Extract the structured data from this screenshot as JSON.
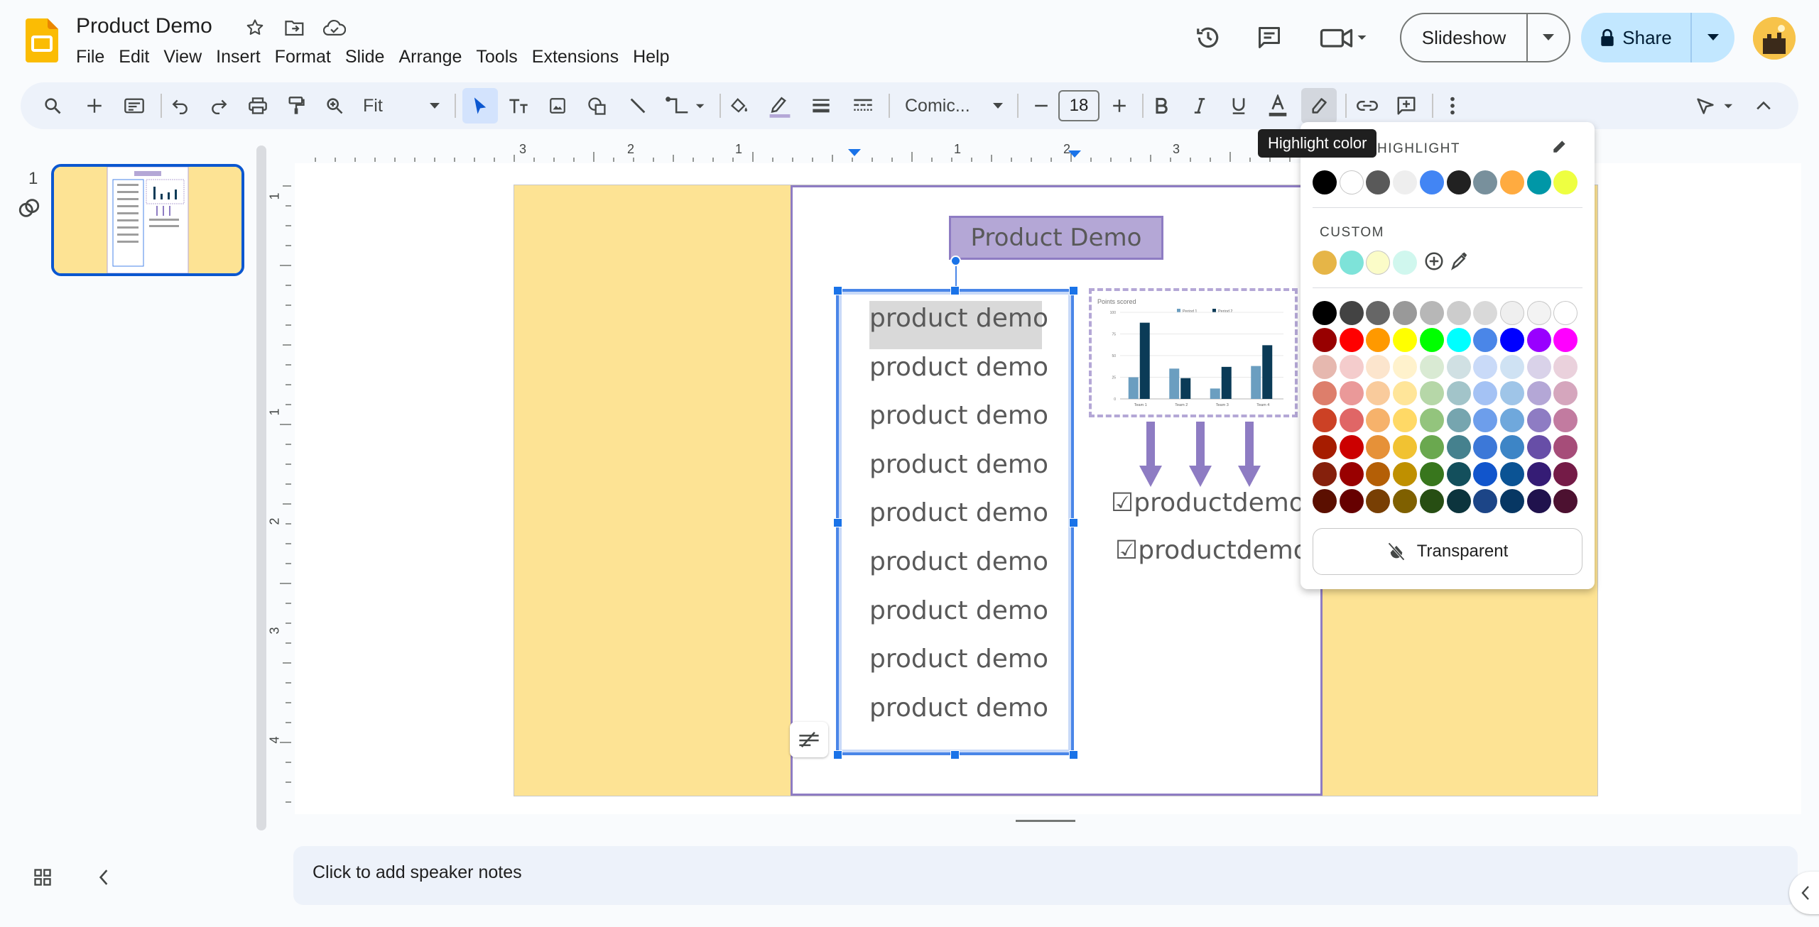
{
  "app": {
    "name": "Google Slides"
  },
  "document": {
    "title": "Product Demo"
  },
  "menu": [
    "File",
    "Edit",
    "View",
    "Insert",
    "Format",
    "Slide",
    "Arrange",
    "Tools",
    "Extensions",
    "Help"
  ],
  "header": {
    "slideshow_label": "Slideshow",
    "share_label": "Share"
  },
  "toolbar": {
    "zoom_label": "Fit",
    "font_label": "Comic...",
    "font_size": "18"
  },
  "tooltip": {
    "text": "Highlight color"
  },
  "ruler": {
    "horizontal": [
      "3",
      "2",
      "1",
      "1",
      "2",
      "3"
    ],
    "vertical": [
      "1",
      "1",
      "2",
      "3",
      "4"
    ]
  },
  "slides_panel": {
    "slide_number": "1"
  },
  "slide": {
    "title": "Product Demo",
    "text_lines": [
      "product demo",
      "product demo",
      "product demo",
      "product demo",
      "product demo",
      "product demo",
      "product demo",
      "product demo",
      "product demo"
    ],
    "checkbox_lines": [
      "☑productdemo",
      "☑productdemo"
    ],
    "chart_title": "Points scored"
  },
  "chart_data": {
    "type": "bar",
    "title": "Points scored",
    "categories": [
      "Team 1",
      "Team 2",
      "Team 3",
      "Team 4"
    ],
    "series": [
      {
        "name": "Period 1",
        "values": [
          25,
          35,
          12,
          38
        ],
        "color": "#6b9ec0"
      },
      {
        "name": "Period 2",
        "values": [
          88,
          24,
          37,
          62
        ],
        "color": "#0b3b57"
      }
    ],
    "ylim": [
      0,
      100
    ],
    "yticks": [
      "0",
      "25",
      "50",
      "75",
      "100"
    ]
  },
  "highlight_popup": {
    "header": "HIGHLIGHT",
    "custom_label": "CUSTOM",
    "transparent_label": "Transparent",
    "theme_colors": [
      "#000000",
      "#ffffff",
      "#595959",
      "#eeeeee",
      "#4285f4",
      "#212121",
      "#78909c",
      "#ffab40",
      "#0097a7",
      "#eeff41"
    ],
    "custom_colors": [
      "#e6b547",
      "#7ee3d9",
      "#fbfcc8",
      "#d0f7ee"
    ],
    "grid_colors": [
      [
        "#000000",
        "#434343",
        "#666666",
        "#999999",
        "#b7b7b7",
        "#cccccc",
        "#d9d9d9",
        "#efefef",
        "#f3f3f3",
        "#ffffff"
      ],
      [
        "#980000",
        "#ff0000",
        "#ff9900",
        "#ffff00",
        "#00ff00",
        "#00ffff",
        "#4a86e8",
        "#0000ff",
        "#9900ff",
        "#ff00ff"
      ],
      [
        "#e6b8af",
        "#f4cccc",
        "#fce5cd",
        "#fff2cc",
        "#d9ead3",
        "#d0e0e3",
        "#c9daf8",
        "#cfe2f3",
        "#d9d2e9",
        "#ead1dc"
      ],
      [
        "#dd7e6b",
        "#ea9999",
        "#f9cb9c",
        "#ffe599",
        "#b6d7a8",
        "#a2c4c9",
        "#a4c2f4",
        "#9fc5e8",
        "#b4a7d6",
        "#d5a6bd"
      ],
      [
        "#cc4125",
        "#e06666",
        "#f6b26b",
        "#ffd966",
        "#93c47d",
        "#76a5af",
        "#6d9eeb",
        "#6fa8dc",
        "#8e7cc3",
        "#c27ba0"
      ],
      [
        "#a61c00",
        "#cc0000",
        "#e69138",
        "#f1c232",
        "#6aa84f",
        "#45818e",
        "#3c78d8",
        "#3d85c6",
        "#674ea7",
        "#a64d79"
      ],
      [
        "#85200c",
        "#990000",
        "#b45f06",
        "#bf9000",
        "#38761d",
        "#134f5c",
        "#1155cc",
        "#0b5394",
        "#351c75",
        "#741b47"
      ],
      [
        "#5b0f00",
        "#660000",
        "#783f04",
        "#7f6000",
        "#274e13",
        "#0c343d",
        "#1c4587",
        "#073763",
        "#20124d",
        "#4c1130"
      ]
    ]
  },
  "notes": {
    "placeholder": "Click to add speaker notes"
  }
}
